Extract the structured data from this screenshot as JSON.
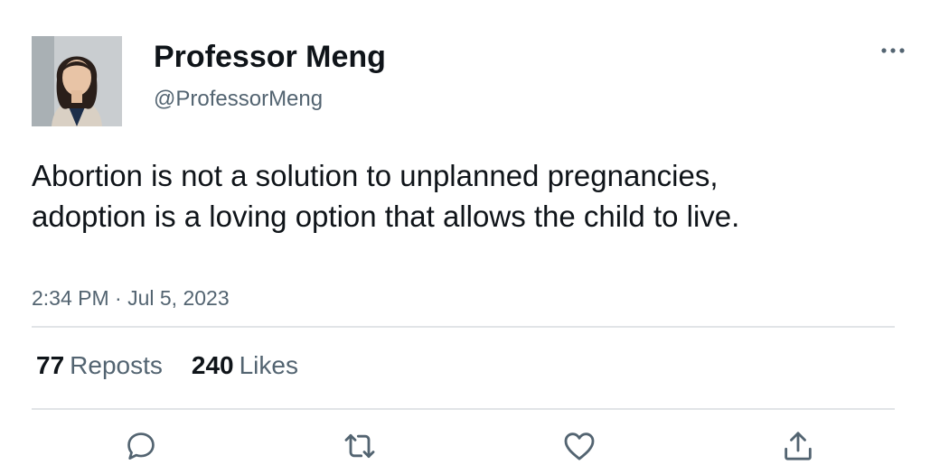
{
  "author": {
    "display_name": "Professor Meng",
    "handle": "@ProfessorMeng",
    "avatar_icon": "profile-photo"
  },
  "tweet": {
    "text": "Abortion is not a solution to unplanned pregnancies, adoption is a loving option that allows the child to live.",
    "timestamp": "2:34 PM · Jul 5, 2023"
  },
  "stats": {
    "reposts_count": "77",
    "reposts_label": "Reposts",
    "likes_count": "240",
    "likes_label": "Likes"
  },
  "actions": [
    "reply-icon",
    "repost-icon",
    "like-icon",
    "share-icon"
  ],
  "colors": {
    "text": "#0f1419",
    "secondary": "#536471",
    "divider": "#e1e4e7"
  }
}
